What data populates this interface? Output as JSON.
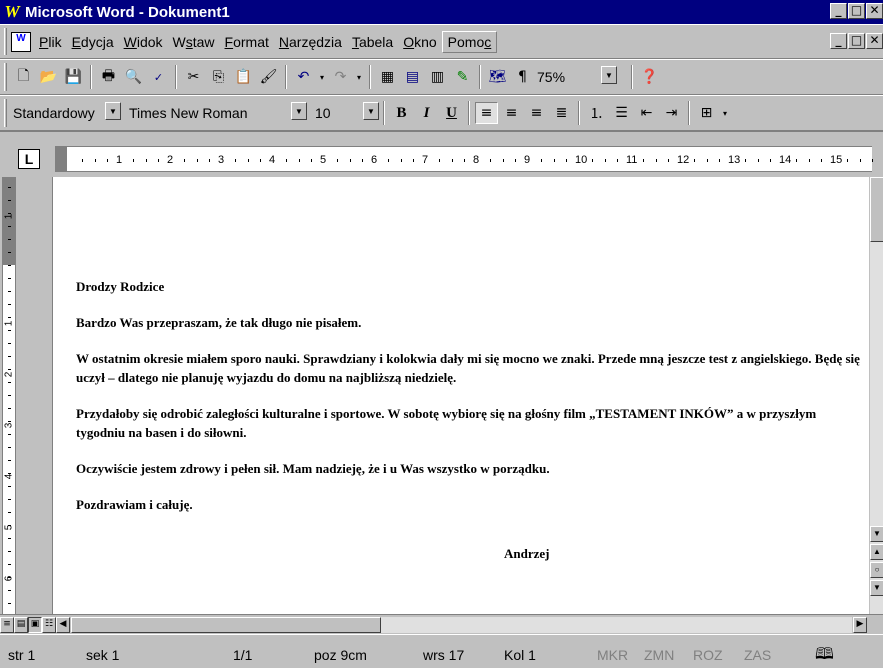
{
  "window": {
    "app_letter": "W",
    "title": "Microsoft Word - Dokument1",
    "controls": [
      "_",
      "□",
      "✕"
    ]
  },
  "menubar": {
    "items": [
      {
        "hot": "P",
        "rest": "lik"
      },
      {
        "hot": "E",
        "rest": "dycja"
      },
      {
        "hot": "W",
        "rest": "idok"
      },
      {
        "pre": "W",
        "hot": "s",
        "rest": "taw"
      },
      {
        "hot": "F",
        "rest": "ormat"
      },
      {
        "hot": "N",
        "rest": "arzędzia"
      },
      {
        "hot": "T",
        "rest": "abela"
      },
      {
        "hot": "O",
        "rest": "kno"
      },
      {
        "pre": "Pomo",
        "hot": "c",
        "rest": ""
      }
    ]
  },
  "toolbar_standard": {
    "zoom": "75%"
  },
  "toolbar_formatting": {
    "style": "Standardowy",
    "font": "Times New Roman",
    "size": "10",
    "bold": "B",
    "italic": "I",
    "underline": "U"
  },
  "ruler": {
    "labels": [
      "1",
      "2",
      "3",
      "4",
      "5",
      "6",
      "7",
      "8",
      "9",
      "10",
      "11",
      "12",
      "13",
      "14",
      "15"
    ],
    "vertical_labels": [
      "1",
      "1",
      "2",
      "3",
      "4",
      "5",
      "6"
    ]
  },
  "document": {
    "paragraphs": [
      "Drodzy Rodzice",
      "Bardzo Was przepraszam, że tak długo nie pisałem.",
      "W ostatnim okresie miałem sporo nauki. Sprawdziany i kolokwia dały mi się mocno we znaki. Przede mną jeszcze test z angielskiego. Będę się uczył – dlatego nie planuję wyjazdu do domu na najbliższą niedzielę.",
      "Przydałoby się odrobić zaległości kulturalne i sportowe. W sobotę wybiorę się na głośny film „TESTAMENT INKÓW” a w przyszłym tygodniu na basen i do siłowni.",
      "Oczywiście jestem zdrowy i pełen sił. Mam nadzieję, że i u Was wszystko w porządku.",
      "Pozdrawiam i całuję."
    ],
    "signature": "Andrzej"
  },
  "statusbar": {
    "page": "str 1",
    "section": "sek 1",
    "pages": "1/1",
    "position": "poz 9cm",
    "line": "wrs 17",
    "column": "Kol 1",
    "mkr": "MKR",
    "zmn": "ZMN",
    "roz": "ROZ",
    "zas": "ZAS"
  }
}
